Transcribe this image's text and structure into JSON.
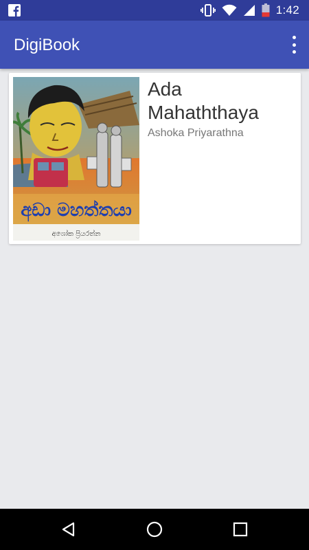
{
  "status_bar": {
    "time": "1:42",
    "icons": [
      "facebook-icon",
      "vibrate-icon",
      "wifi-icon",
      "signal-icon",
      "battery-low-icon"
    ]
  },
  "app_bar": {
    "title": "DigiBook",
    "menu_icon": "overflow-menu-icon"
  },
  "books": [
    {
      "title": "Ada Mahaththaya",
      "author": "Ashoka Priyarathna",
      "cover_title_sinhala": "අඩා මහත්තයා",
      "cover_author_sinhala": "අශෝක ප්‍රියරත්න"
    }
  ],
  "colors": {
    "primary": "#3f51b5",
    "primary_dark": "#2f3c99",
    "background": "#e9eaed"
  },
  "nav_bar": {
    "icons": [
      "back-icon",
      "home-icon",
      "recents-icon"
    ]
  }
}
